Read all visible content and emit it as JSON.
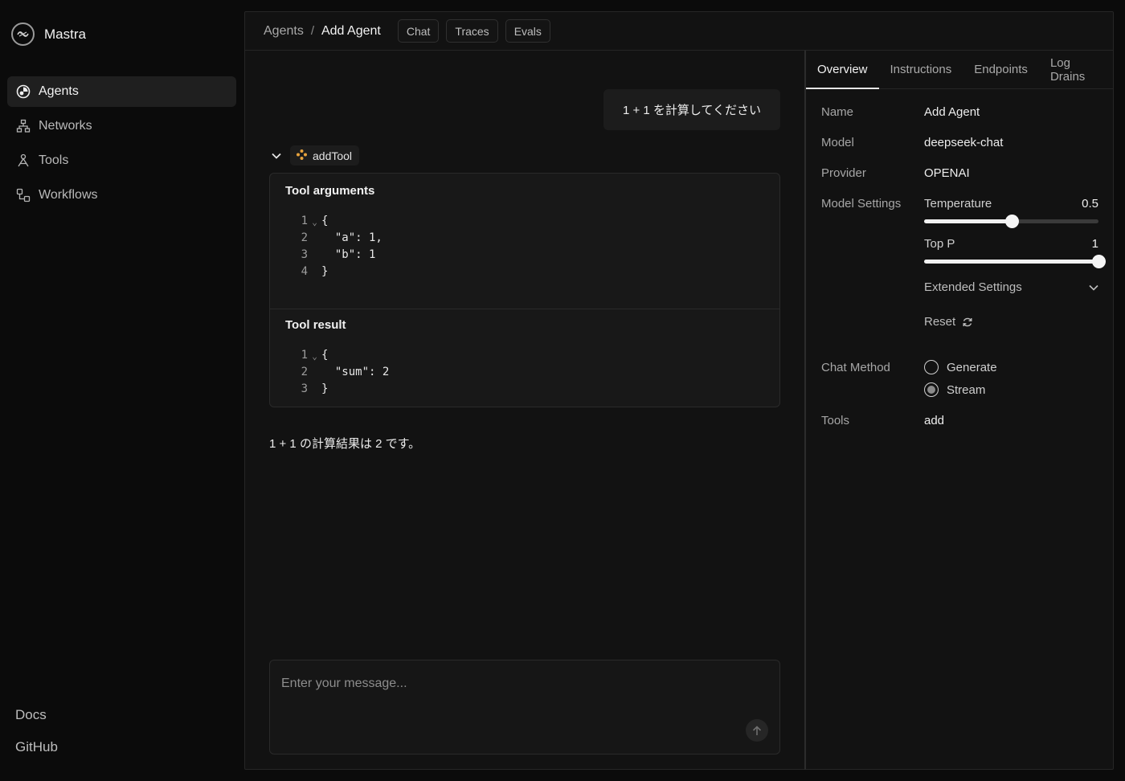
{
  "brand": {
    "name": "Mastra"
  },
  "sidebar": {
    "items": [
      {
        "label": "Agents",
        "icon": "globe-icon",
        "active": true
      },
      {
        "label": "Networks",
        "icon": "network-icon",
        "active": false
      },
      {
        "label": "Tools",
        "icon": "tools-icon",
        "active": false
      },
      {
        "label": "Workflows",
        "icon": "workflow-icon",
        "active": false
      }
    ],
    "footer": [
      {
        "label": "Docs"
      },
      {
        "label": "GitHub"
      }
    ]
  },
  "header": {
    "breadcrumb_root": "Agents",
    "breadcrumb_sep": "/",
    "breadcrumb_current": "Add Agent",
    "tabs": [
      {
        "label": "Chat"
      },
      {
        "label": "Traces"
      },
      {
        "label": "Evals"
      }
    ]
  },
  "chat": {
    "user_message": "1 + 1 を計算してください",
    "tool": {
      "name": "addTool",
      "args_title": "Tool arguments",
      "args_lines": [
        {
          "n": "1",
          "fold": true,
          "text": "{"
        },
        {
          "n": "2",
          "fold": false,
          "text": "  \"a\": 1,"
        },
        {
          "n": "3",
          "fold": false,
          "text": "  \"b\": 1"
        },
        {
          "n": "4",
          "fold": false,
          "text": "}"
        }
      ],
      "result_title": "Tool result",
      "result_lines": [
        {
          "n": "1",
          "fold": true,
          "text": "{"
        },
        {
          "n": "2",
          "fold": false,
          "text": "  \"sum\": 2"
        },
        {
          "n": "3",
          "fold": false,
          "text": "}"
        }
      ]
    },
    "assistant_message": "1 + 1 の計算結果は 2 です。",
    "composer": {
      "placeholder": "Enter your message...",
      "value": ""
    }
  },
  "panel": {
    "tabs": [
      {
        "label": "Overview",
        "active": true
      },
      {
        "label": "Instructions"
      },
      {
        "label": "Endpoints"
      },
      {
        "label": "Log Drains"
      }
    ],
    "name_label": "Name",
    "name_value": "Add Agent",
    "model_label": "Model",
    "model_value": "deepseek-chat",
    "provider_label": "Provider",
    "provider_value": "OPENAI",
    "model_settings_label": "Model Settings",
    "temperature_label": "Temperature",
    "temperature_value": "0.5",
    "temperature_fraction": 0.5,
    "top_p_label": "Top P",
    "top_p_value": "1",
    "top_p_fraction": 1.0,
    "extended_settings_label": "Extended Settings",
    "reset_label": "Reset",
    "chat_method_label": "Chat Method",
    "chat_methods": [
      {
        "label": "Generate",
        "selected": false
      },
      {
        "label": "Stream",
        "selected": true
      }
    ],
    "tools_label": "Tools",
    "tools_value": "add"
  },
  "colors": {
    "background": "#0b0b0b",
    "panel": "#121212",
    "accent_tool_icon": "#e8a33d"
  }
}
